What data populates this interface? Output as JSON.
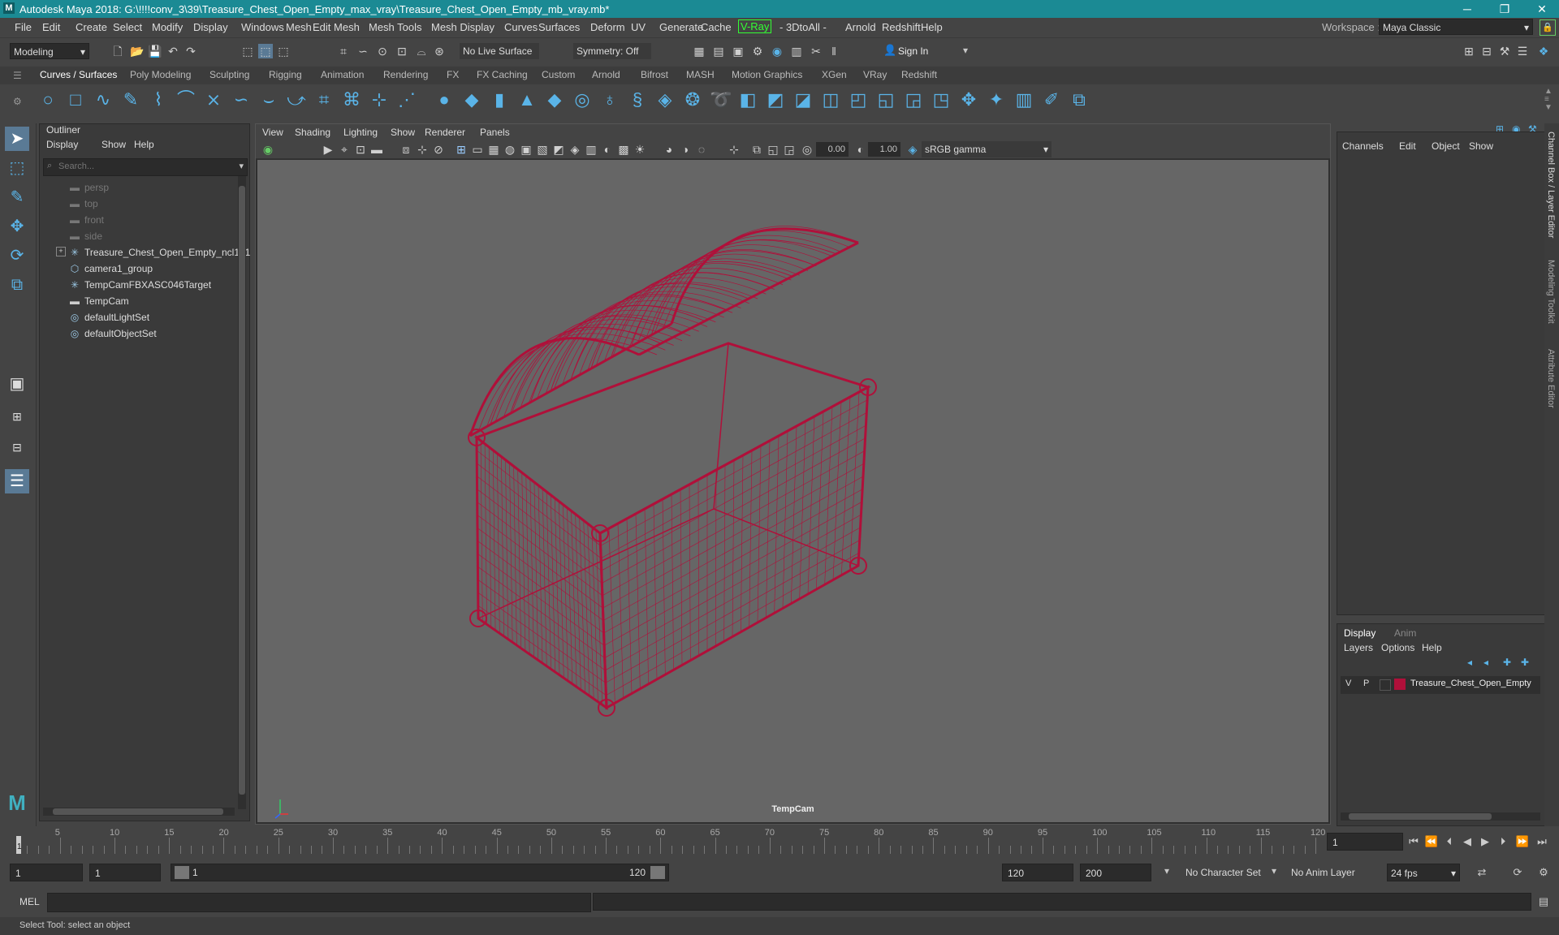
{
  "window": {
    "title": "Autodesk Maya 2018: G:\\!!!!conv_3\\39\\Treasure_Chest_Open_Empty_max_vray\\Treasure_Chest_Open_Empty_mb_vray.mb*",
    "minimize": "─",
    "maximize": "❐",
    "close": "✕"
  },
  "menubar": {
    "items": [
      "File",
      "Edit",
      "Create",
      "Select",
      "Modify",
      "Display",
      "Windows",
      "Mesh",
      "Edit Mesh",
      "Mesh Tools",
      "Mesh Display",
      "Curves",
      "Surfaces",
      "Deform",
      "UV",
      "Generate",
      "Cache",
      "V-Ray",
      "- 3DtoAll -",
      "Arnold",
      "Redshift",
      "Help"
    ],
    "workspace_label": "Workspace :",
    "workspace_value": "Maya Classic"
  },
  "statusline": {
    "menuset": "Modeling",
    "live_surface": "No Live Surface",
    "symmetry": "Symmetry: Off",
    "sign_in": "Sign In"
  },
  "shelf": {
    "tabs": [
      "Curves / Surfaces",
      "Poly Modeling",
      "Sculpting",
      "Rigging",
      "Animation",
      "Rendering",
      "FX",
      "FX Caching",
      "Custom",
      "Arnold",
      "Bifrost",
      "MASH",
      "Motion Graphics",
      "XGen",
      "VRay",
      "Redshift"
    ],
    "active_tab": "Curves / Surfaces"
  },
  "outliner": {
    "title": "Outliner",
    "menu": [
      "Display",
      "Show",
      "Help"
    ],
    "search_placeholder": "Search...",
    "items": [
      {
        "label": "persp",
        "icon": "camera-icon",
        "dim": true
      },
      {
        "label": "top",
        "icon": "camera-icon",
        "dim": true
      },
      {
        "label": "front",
        "icon": "camera-icon",
        "dim": true
      },
      {
        "label": "side",
        "icon": "camera-icon",
        "dim": true
      },
      {
        "label": "Treasure_Chest_Open_Empty_ncl1_1",
        "icon": "transform-icon",
        "dim": false,
        "expandable": true
      },
      {
        "label": "camera1_group",
        "icon": "group-icon",
        "dim": false
      },
      {
        "label": "TempCamFBXASC046Target",
        "icon": "transform-icon",
        "dim": false
      },
      {
        "label": "TempCam",
        "icon": "camera-icon",
        "dim": false
      },
      {
        "label": "defaultLightSet",
        "icon": "set-icon",
        "dim": false
      },
      {
        "label": "defaultObjectSet",
        "icon": "set-icon",
        "dim": false
      }
    ]
  },
  "viewport": {
    "menu": [
      "View",
      "Shading",
      "Lighting",
      "Show",
      "Renderer",
      "Panels"
    ],
    "exposure": "0.00",
    "gamma": "1.00",
    "colorspace": "sRGB gamma",
    "camera_label": "TempCam",
    "wire_color": "#b0103a"
  },
  "channelbox": {
    "menu": [
      "Channels",
      "Edit",
      "Object",
      "Show"
    ]
  },
  "layereditor": {
    "tabs": [
      "Display",
      "Anim"
    ],
    "active_tab": "Display",
    "menu": [
      "Layers",
      "Options",
      "Help"
    ],
    "layer": {
      "v": "V",
      "p": "P",
      "name": "Treasure_Chest_Open_Empty",
      "color": "#b0103a"
    }
  },
  "side_tabs": [
    "Channel Box / Layer Editor",
    "Modeling Toolkit",
    "Attribute Editor"
  ],
  "timeslider": {
    "ticks": [
      "5",
      "10",
      "15",
      "20",
      "25",
      "30",
      "35",
      "40",
      "45",
      "50",
      "55",
      "60",
      "65",
      "70",
      "75",
      "80",
      "85",
      "90",
      "95",
      "100",
      "105",
      "110",
      "115",
      "120"
    ],
    "current_marker": "1",
    "current_frame": "1"
  },
  "rangeslider": {
    "start": "1",
    "playback_start": "1",
    "range_start_label": "1",
    "range_end_label": "120",
    "playback_end": "120",
    "end": "200",
    "character_set": "No Character Set",
    "anim_layer": "No Anim Layer",
    "fps": "24 fps"
  },
  "cmdline": {
    "language": "MEL"
  },
  "helpline": {
    "text": "Select Tool: select an object"
  }
}
